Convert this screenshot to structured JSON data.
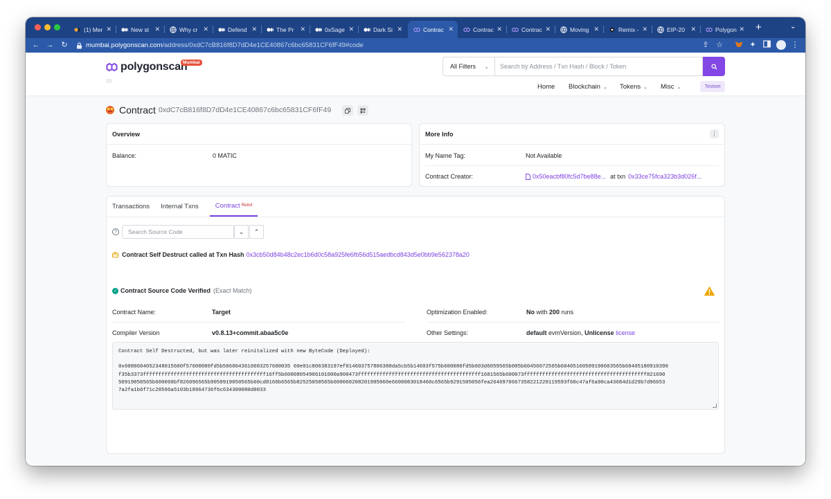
{
  "browser": {
    "tabs": [
      {
        "title": "(1) Mer",
        "icon": "medium-icon"
      },
      {
        "title": "New st",
        "icon": "medium-icon"
      },
      {
        "title": "Why cr",
        "icon": "globe-icon"
      },
      {
        "title": "Defend",
        "icon": "medium-icon"
      },
      {
        "title": "The Pr",
        "icon": "medium-icon"
      },
      {
        "title": "0xSage",
        "icon": "medium-icon"
      },
      {
        "title": "Dark Si",
        "icon": "medium-icon"
      },
      {
        "title": "Contrac",
        "icon": "polygon-icon"
      },
      {
        "title": "Contrac",
        "icon": "polygon-icon"
      },
      {
        "title": "Contrac",
        "icon": "polygon-icon"
      },
      {
        "title": "Moving",
        "icon": "globe-icon"
      },
      {
        "title": "Remix -",
        "icon": "remix-icon"
      },
      {
        "title": "EIP-20",
        "icon": "globe-icon"
      },
      {
        "title": "Polygon",
        "icon": "polygon-icon"
      }
    ],
    "active_tab_index": 7,
    "url_host": "mumbai.polygonscan.com",
    "url_path": "/address/0xdC7cB816f8D7dD4e1CE40867c6bc65831CF6fF49#code"
  },
  "header": {
    "logo_text": "polygonscan",
    "logo_badge": "Mumbai",
    "filter_label": "All Filters",
    "search_placeholder": "Search by Address / Txn Hash / Block / Token",
    "nav": {
      "home": "Home",
      "blockchain": "Blockchain",
      "tokens": "Tokens",
      "misc": "Misc"
    },
    "testnet_badge": "Testnet"
  },
  "contract": {
    "label": "Contract",
    "address": "0xdC7cB816f8D7dD4e1CE40867c6bc65831CF6fF49"
  },
  "overview": {
    "title": "Overview",
    "balance_label": "Balance:",
    "balance_value": "0 MATIC"
  },
  "more_info": {
    "title": "More Info",
    "name_tag_label": "My Name Tag:",
    "name_tag_value": "Not Available",
    "creator_label": "Contract Creator:",
    "creator_address": "0x50eacbf80fc5d7be88e...",
    "at_txn": "at txn",
    "creator_txn": "0x33ce75fca323b3d026f..."
  },
  "tabs": {
    "transactions": "Transactions",
    "internal": "Internal Txns",
    "contract": "Contract",
    "contract_sup": "ReInit"
  },
  "code": {
    "search_placeholder": "Search Source Code",
    "self_destruct_text": "Contract Self Destruct called at Txn Hash",
    "self_destruct_hash": "0x3cb50d84b48c2ec1b6d0c58a925fe6fb56d515aedbcd843d5e0bb9e562378a20",
    "verified_label": "Contract Source Code Verified",
    "verified_match": "(Exact Match)",
    "name_label": "Contract Name:",
    "name_value": "Target",
    "compiler_label": "Compiler Version",
    "compiler_value": "v0.8.13+commit.abaa5c0e",
    "optimization_label": "Optimization Enabled:",
    "optimization_value": "No",
    "optimization_with": "with",
    "optimization_runs": "200",
    "optimization_runs_label": "runs",
    "settings_label": "Other Settings:",
    "settings_default": "default",
    "settings_evm": "evmVersion,",
    "settings_license_type": "Unlicense",
    "settings_license": "license",
    "bytecode_header": "Contract Self Destructed, but was later reinitalized with new ByteCode (Deployed):",
    "bytecode_lines": [
      "0x6080604052348015600f57600080fd5b5060043610603257600035 60e01c806383197ef014603757806380da5cb5b14603f575b600080fd5b603d6059565b005b60456072565b60405160509190603565b60405180910390",
      "f35b3373ffffffffffffffffffffffffffffffffffffffff16ff5b60008054906101000a900473ffffffffffffffffffffffffffffffffffffffff1681565b600073ffffffffffffffffffffffffffffffffffffffff821690",
      "50919050565b600060bf826096565b9050919050565b60cd8160b6565b82525050565b600060208201905060e6600083018460c6565b9291505056fea2646970667358221220119593f60c47af6a90ca43684d1d29b7d96653",
      "7a2fa1b6f71c28596a5103b18964736f6c634300080d0033"
    ]
  }
}
